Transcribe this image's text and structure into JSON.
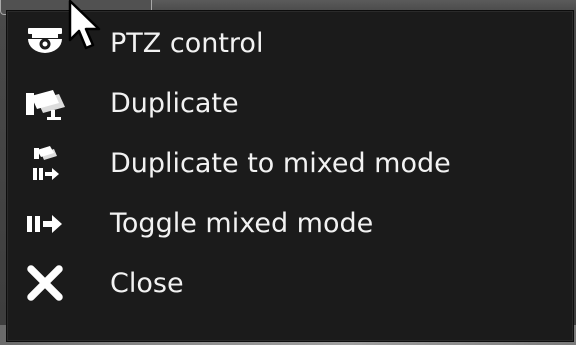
{
  "menu": {
    "items": [
      {
        "icon": "ptz-dome-camera-icon",
        "label": "PTZ control"
      },
      {
        "icon": "duplicate-camera-icon",
        "label": "Duplicate"
      },
      {
        "icon": "duplicate-mixed-mode-icon",
        "label": "Duplicate to mixed mode"
      },
      {
        "icon": "toggle-mixed-mode-icon",
        "label": "Toggle mixed mode"
      },
      {
        "icon": "close-x-icon",
        "label": "Close"
      }
    ]
  },
  "colors": {
    "menu_background": "#1b1b1b",
    "text": "#f2f2f2",
    "icon": "#ffffff"
  }
}
